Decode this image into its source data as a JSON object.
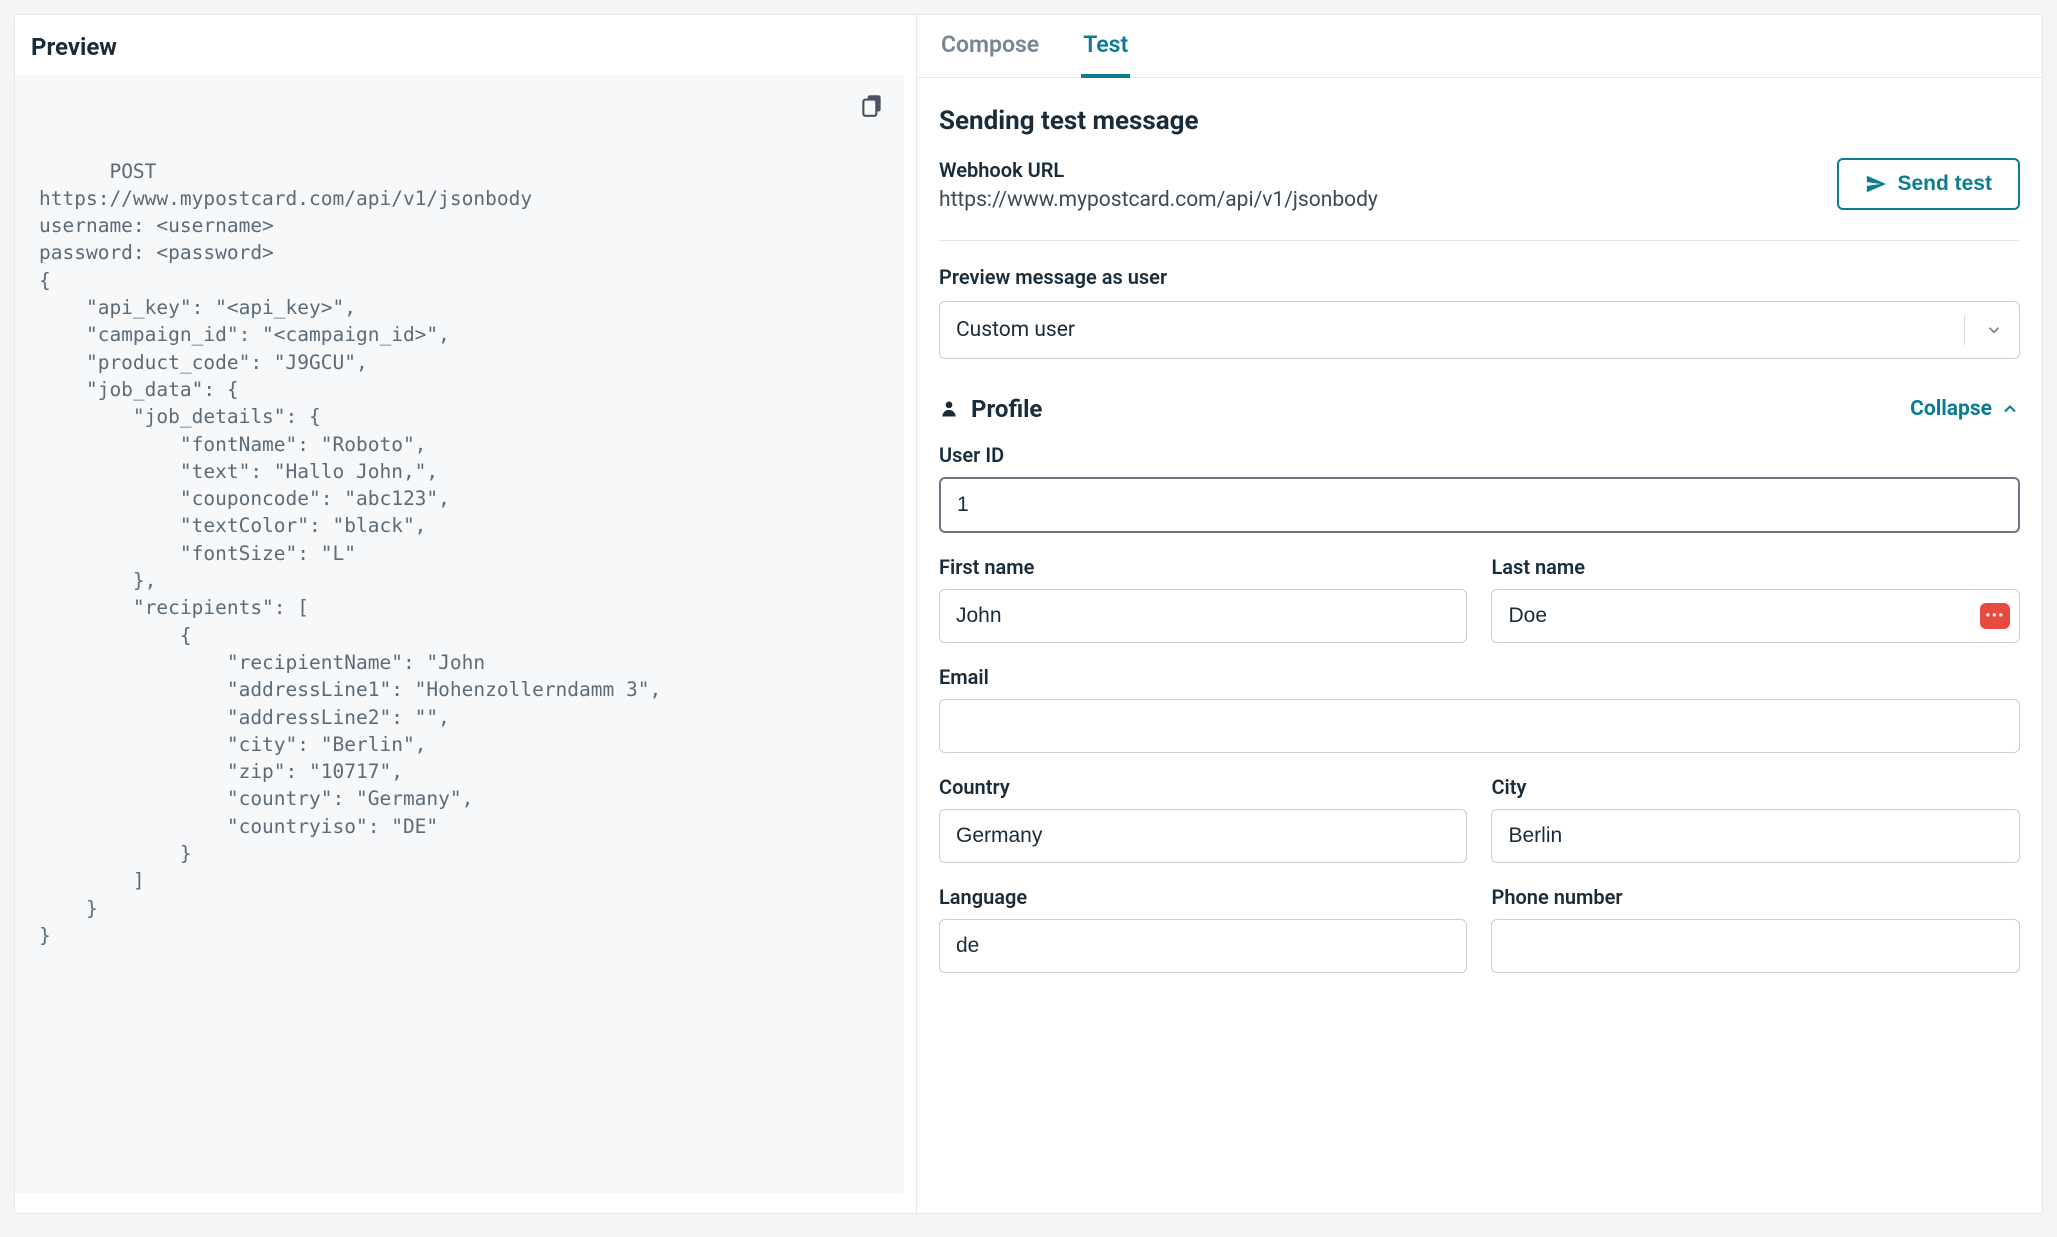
{
  "left": {
    "header": "Preview",
    "code": "POST\nhttps://www.mypostcard.com/api/v1/jsonbody\nusername: <username>\npassword: <password>\n{\n    \"api_key\": \"<api_key>\",\n    \"campaign_id\": \"<campaign_id>\",\n    \"product_code\": \"J9GCU\",\n    \"job_data\": {\n        \"job_details\": {\n            \"fontName\": \"Roboto\",\n            \"text\": \"Hallo John,\",\n            \"couponcode\": \"abc123\",\n            \"textColor\": \"black\",\n            \"fontSize\": \"L\"\n        },\n        \"recipients\": [\n            {\n                \"recipientName\": \"John\n                \"addressLine1\": \"Hohenzollerndamm 3\",\n                \"addressLine2\": \"\",\n                \"city\": \"Berlin\",\n                \"zip\": \"10717\",\n                \"country\": \"Germany\",\n                \"countryiso\": \"DE\"\n            }\n        ]\n    }\n}"
  },
  "tabs": {
    "compose": "Compose",
    "test": "Test"
  },
  "sending": {
    "title": "Sending test message",
    "webhook_label": "Webhook URL",
    "webhook_url": "https://www.mypostcard.com/api/v1/jsonbody",
    "send_label": "Send test"
  },
  "preview_user": {
    "label": "Preview message as user",
    "selected": "Custom user"
  },
  "profile": {
    "title": "Profile",
    "collapse_label": "Collapse",
    "fields": {
      "user_id": {
        "label": "User ID",
        "value": "1"
      },
      "first_name": {
        "label": "First name",
        "value": "John"
      },
      "last_name": {
        "label": "Last name",
        "value": "Doe"
      },
      "email": {
        "label": "Email",
        "value": ""
      },
      "country": {
        "label": "Country",
        "value": "Germany"
      },
      "city": {
        "label": "City",
        "value": "Berlin"
      },
      "language": {
        "label": "Language",
        "value": "de"
      },
      "phone": {
        "label": "Phone number",
        "value": ""
      }
    }
  }
}
